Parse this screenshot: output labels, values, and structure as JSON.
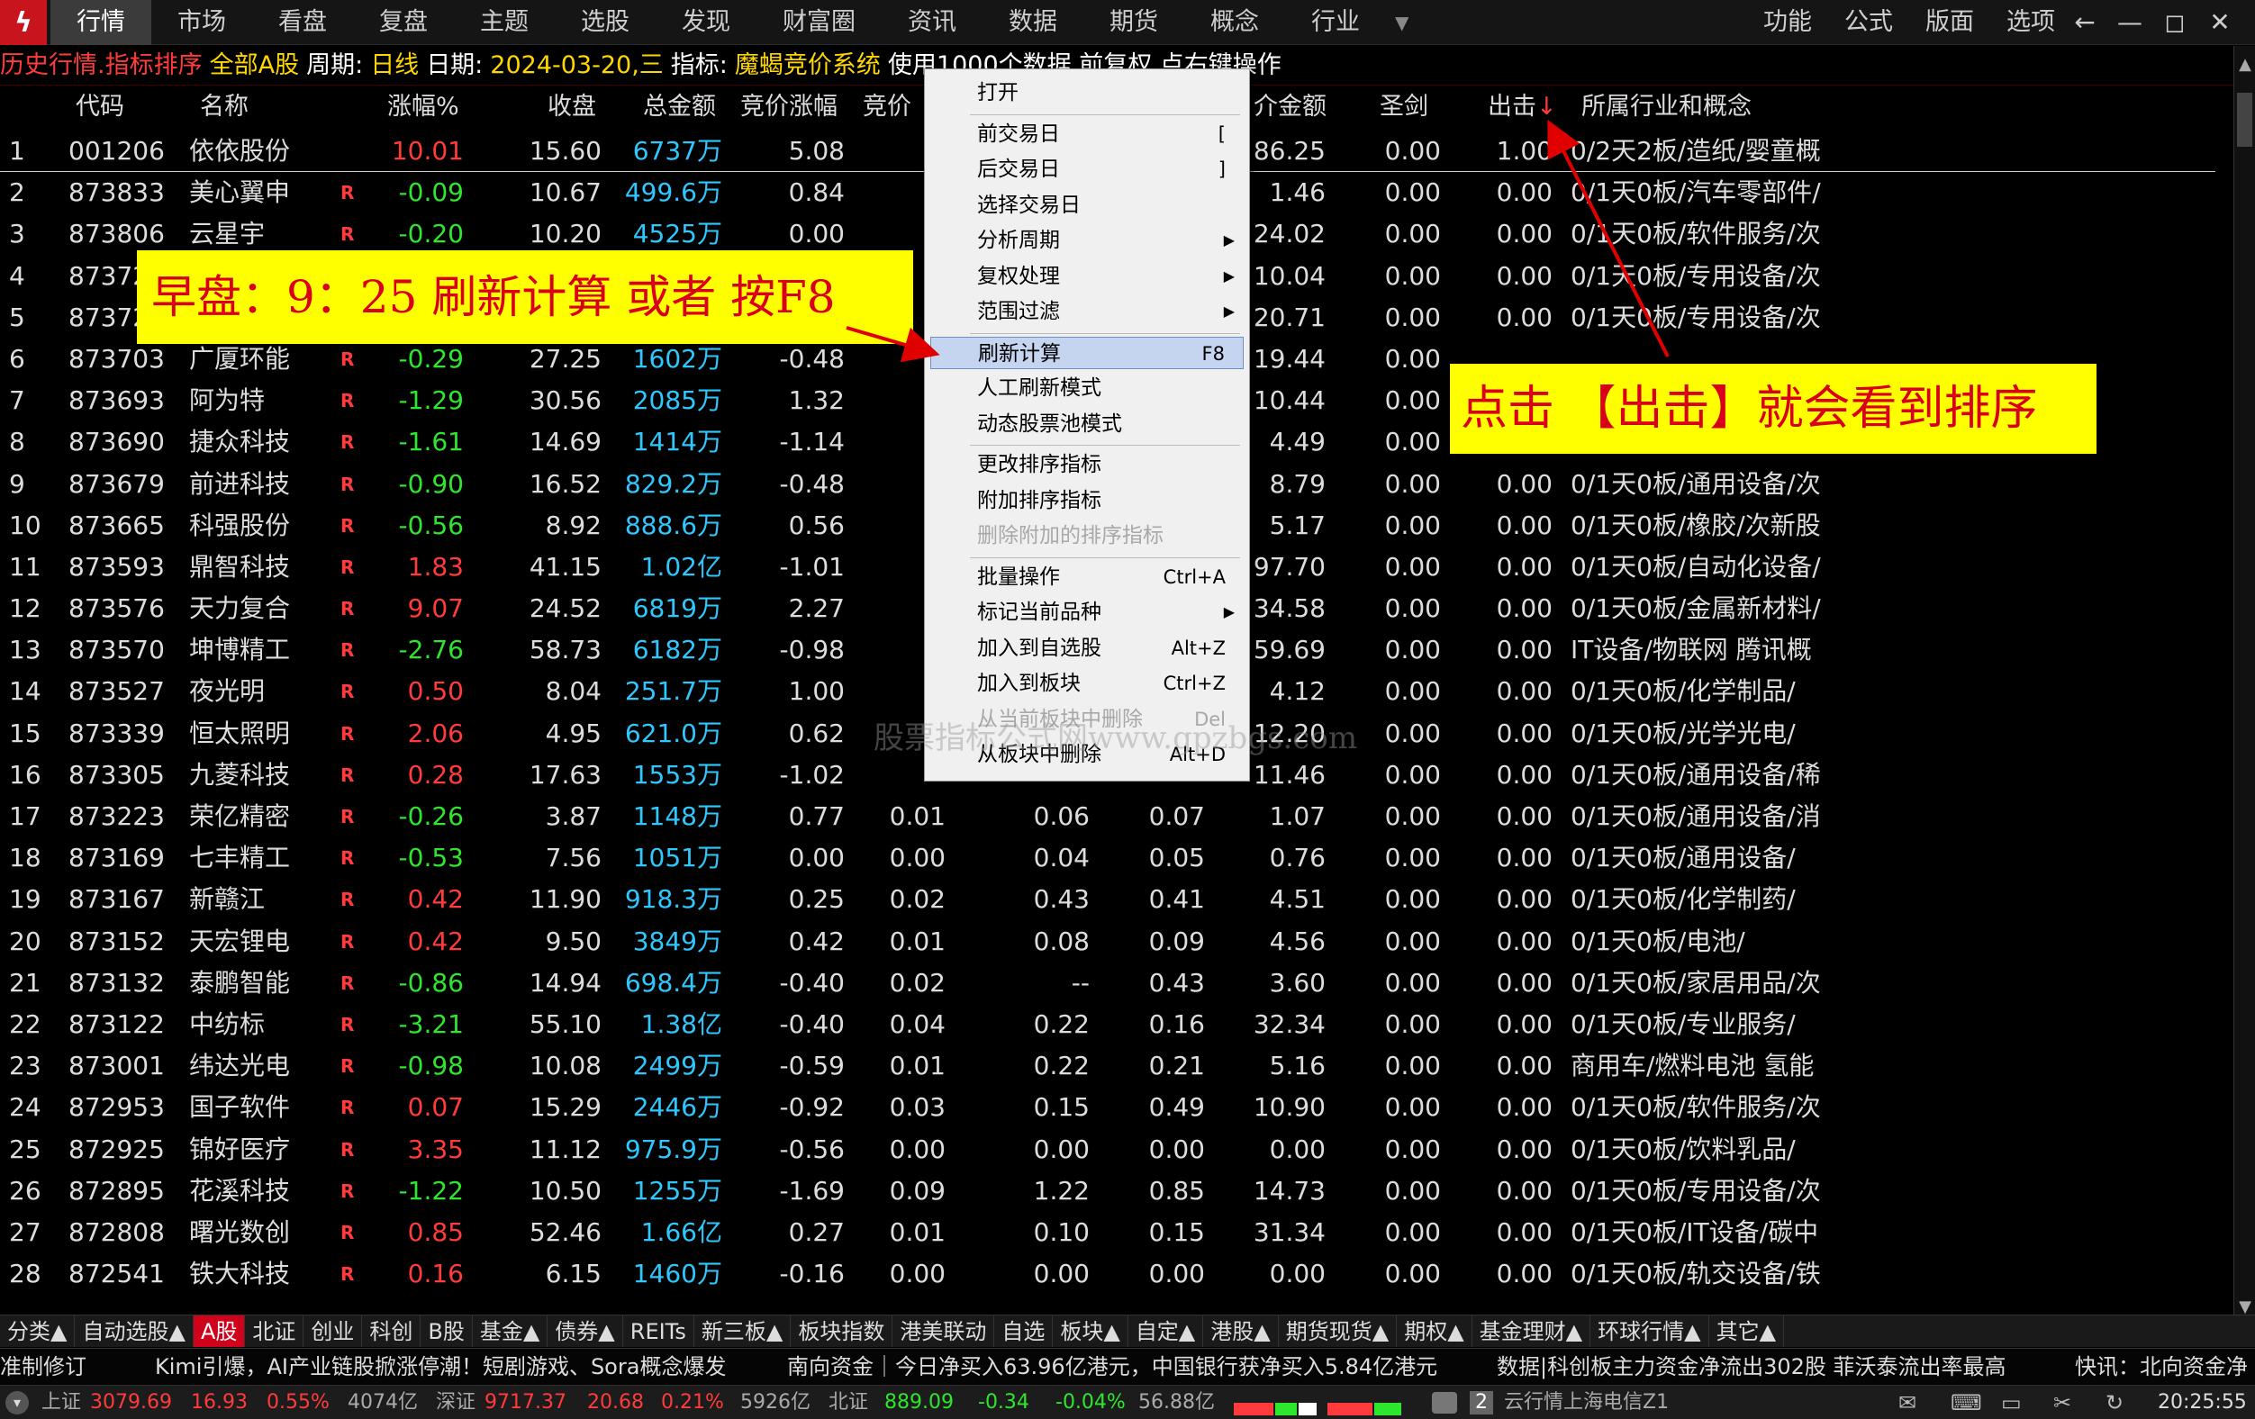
{
  "menubar": {
    "items": [
      "行情",
      "市场",
      "看盘",
      "复盘",
      "主题",
      "选股",
      "发现",
      "财富圈",
      "资讯",
      "数据",
      "期货",
      "概念",
      "行业"
    ],
    "right_items": [
      "功能",
      "公式",
      "版面",
      "选项"
    ],
    "window_controls": [
      "←",
      "—",
      "◻",
      "✕"
    ]
  },
  "infobar": {
    "title": "历史行情.指标排序",
    "market": "全部A股",
    "period_label": "周期:",
    "period": "日线",
    "date_label": "日期:",
    "date": "2024-03-20,三",
    "indicator_label": "指标:",
    "indicator": "魔蝎竞价系统",
    "tail": "使用1000个数据 前复权 点右键操作"
  },
  "columns": {
    "code": "代码",
    "name": "名称",
    "chg": "涨幅%",
    "close": "收盘",
    "amount": "总金额",
    "auc_chg": "竞价涨幅",
    "auc_more": "竞价",
    "v11_label": "介金额",
    "sword": "圣剑",
    "strike": "出击",
    "industry": "所属行业和概念",
    "sort_arrow": "↓"
  },
  "rows": [
    {
      "i": "1",
      "code": "001206",
      "name": "依依股份",
      "r": "",
      "chg": "10.01",
      "close": "15.60",
      "amt": "6737万",
      "auc": "5.08",
      "v6": "",
      "v7": "",
      "v8": "",
      "v9": "86.25",
      "v10": "0.00",
      "v11": "1.00",
      "ind": "0/2天2板/造纸/婴童概"
    },
    {
      "i": "2",
      "code": "873833",
      "name": "美心翼申",
      "r": "R",
      "chg": "-0.09",
      "close": "10.67",
      "amt": "499.6万",
      "auc": "0.84",
      "v6": "",
      "v7": "",
      "v8": "",
      "v9": "1.46",
      "v10": "0.00",
      "v11": "0.00",
      "ind": "0/1天0板/汽车零部件/"
    },
    {
      "i": "3",
      "code": "873806",
      "name": "云星宇",
      "r": "R",
      "chg": "-0.20",
      "close": "10.20",
      "amt": "4525万",
      "auc": "0.00",
      "v6": "",
      "v7": "",
      "v8": "",
      "v9": "24.02",
      "v10": "0.00",
      "v11": "0.00",
      "ind": "0/1天0板/软件服务/次"
    },
    {
      "i": "4",
      "code": "873727",
      "name": "",
      "r": "",
      "chg": "",
      "close": "",
      "amt": "",
      "auc": "",
      "v6": "",
      "v7": "",
      "v8": "",
      "v9": "10.04",
      "v10": "0.00",
      "v11": "0.00",
      "ind": "0/1天0板/专用设备/次"
    },
    {
      "i": "5",
      "code": "873726",
      "name": "",
      "r": "",
      "chg": "",
      "close": "",
      "amt": "",
      "auc": "",
      "v6": "",
      "v7": "",
      "v8": "",
      "v9": "20.71",
      "v10": "0.00",
      "v11": "0.00",
      "ind": "0/1天0板/专用设备/次"
    },
    {
      "i": "6",
      "code": "873703",
      "name": "广厦环能",
      "r": "R",
      "chg": "-0.29",
      "close": "27.25",
      "amt": "1602万",
      "auc": "-0.48",
      "v6": "",
      "v7": "",
      "v8": "",
      "v9": "19.44",
      "v10": "0.00",
      "v11": "",
      "ind": ""
    },
    {
      "i": "7",
      "code": "873693",
      "name": "阿为特",
      "r": "R",
      "chg": "-1.29",
      "close": "30.56",
      "amt": "2085万",
      "auc": "1.32",
      "v6": "",
      "v7": "",
      "v8": "",
      "v9": "10.44",
      "v10": "0.00",
      "v11": "",
      "ind": ""
    },
    {
      "i": "8",
      "code": "873690",
      "name": "捷众科技",
      "r": "R",
      "chg": "-1.61",
      "close": "14.69",
      "amt": "1414万",
      "auc": "-1.14",
      "v6": "",
      "v7": "",
      "v8": "",
      "v9": "4.49",
      "v10": "0.00",
      "v11": "",
      "ind": ""
    },
    {
      "i": "9",
      "code": "873679",
      "name": "前进科技",
      "r": "R",
      "chg": "-0.90",
      "close": "16.52",
      "amt": "829.2万",
      "auc": "-0.48",
      "v6": "",
      "v7": "",
      "v8": "",
      "v9": "8.79",
      "v10": "0.00",
      "v11": "0.00",
      "ind": "0/1天0板/通用设备/次"
    },
    {
      "i": "10",
      "code": "873665",
      "name": "科强股份",
      "r": "R",
      "chg": "-0.56",
      "close": "8.92",
      "amt": "888.6万",
      "auc": "0.56",
      "v6": "",
      "v7": "",
      "v8": "",
      "v9": "5.17",
      "v10": "0.00",
      "v11": "0.00",
      "ind": "0/1天0板/橡胶/次新股"
    },
    {
      "i": "11",
      "code": "873593",
      "name": "鼎智科技",
      "r": "R",
      "chg": "1.83",
      "close": "41.15",
      "amt": "1.02亿",
      "auc": "-1.01",
      "v6": "",
      "v7": "",
      "v8": "",
      "v9": "97.70",
      "v10": "0.00",
      "v11": "0.00",
      "ind": "0/1天0板/自动化设备/"
    },
    {
      "i": "12",
      "code": "873576",
      "name": "天力复合",
      "r": "R",
      "chg": "9.07",
      "close": "24.52",
      "amt": "6819万",
      "auc": "2.27",
      "v6": "",
      "v7": "",
      "v8": "",
      "v9": "34.58",
      "v10": "0.00",
      "v11": "0.00",
      "ind": "0/1天0板/金属新材料/"
    },
    {
      "i": "13",
      "code": "873570",
      "name": "坤博精工",
      "r": "R",
      "chg": "-2.76",
      "close": "58.73",
      "amt": "6182万",
      "auc": "-0.98",
      "v6": "",
      "v7": "",
      "v8": "",
      "v9": "59.69",
      "v10": "0.00",
      "v11": "0.00",
      "ind": "IT设备/物联网 腾讯概"
    },
    {
      "i": "14",
      "code": "873527",
      "name": "夜光明",
      "r": "R",
      "chg": "0.50",
      "close": "8.04",
      "amt": "251.7万",
      "auc": "1.00",
      "v6": "",
      "v7": "",
      "v8": "",
      "v9": "4.12",
      "v10": "0.00",
      "v11": "0.00",
      "ind": "0/1天0板/化学制品/"
    },
    {
      "i": "15",
      "code": "873339",
      "name": "恒太照明",
      "r": "R",
      "chg": "2.06",
      "close": "4.95",
      "amt": "621.0万",
      "auc": "0.62",
      "v6": "",
      "v7": "",
      "v8": "",
      "v9": "12.20",
      "v10": "0.00",
      "v11": "0.00",
      "ind": "0/1天0板/光学光电/"
    },
    {
      "i": "16",
      "code": "873305",
      "name": "九菱科技",
      "r": "R",
      "chg": "0.28",
      "close": "17.63",
      "amt": "1553万",
      "auc": "-1.02",
      "v6": "",
      "v7": "",
      "v8": "",
      "v9": "11.46",
      "v10": "0.00",
      "v11": "0.00",
      "ind": "0/1天0板/通用设备/稀"
    },
    {
      "i": "17",
      "code": "873223",
      "name": "荣亿精密",
      "r": "R",
      "chg": "-0.26",
      "close": "3.87",
      "amt": "1148万",
      "auc": "0.77",
      "v6": "0.01",
      "v7": "0.06",
      "v8": "0.07",
      "v9": "1.07",
      "v10": "0.00",
      "v11": "0.00",
      "ind": "0/1天0板/通用设备/消"
    },
    {
      "i": "18",
      "code": "873169",
      "name": "七丰精工",
      "r": "R",
      "chg": "-0.53",
      "close": "7.56",
      "amt": "1051万",
      "auc": "0.00",
      "v6": "0.00",
      "v7": "0.04",
      "v8": "0.05",
      "v9": "0.76",
      "v10": "0.00",
      "v11": "0.00",
      "ind": "0/1天0板/通用设备/"
    },
    {
      "i": "19",
      "code": "873167",
      "name": "新赣江",
      "r": "R",
      "chg": "0.42",
      "close": "11.90",
      "amt": "918.3万",
      "auc": "0.25",
      "v6": "0.02",
      "v7": "0.43",
      "v8": "0.41",
      "v9": "4.51",
      "v10": "0.00",
      "v11": "0.00",
      "ind": "0/1天0板/化学制药/"
    },
    {
      "i": "20",
      "code": "873152",
      "name": "天宏锂电",
      "r": "R",
      "chg": "0.42",
      "close": "9.50",
      "amt": "3849万",
      "auc": "0.42",
      "v6": "0.01",
      "v7": "0.08",
      "v8": "0.09",
      "v9": "4.56",
      "v10": "0.00",
      "v11": "0.00",
      "ind": "0/1天0板/电池/"
    },
    {
      "i": "21",
      "code": "873132",
      "name": "泰鹏智能",
      "r": "R",
      "chg": "-0.86",
      "close": "14.94",
      "amt": "698.4万",
      "auc": "-0.40",
      "v6": "0.02",
      "v7": "--",
      "v8": "0.43",
      "v9": "3.60",
      "v10": "0.00",
      "v11": "0.00",
      "ind": "0/1天0板/家居用品/次"
    },
    {
      "i": "22",
      "code": "873122",
      "name": "中纺标",
      "r": "R",
      "chg": "-3.21",
      "close": "55.10",
      "amt": "1.38亿",
      "auc": "-0.40",
      "v6": "0.04",
      "v7": "0.22",
      "v8": "0.16",
      "v9": "32.34",
      "v10": "0.00",
      "v11": "0.00",
      "ind": "0/1天0板/专业服务/"
    },
    {
      "i": "23",
      "code": "873001",
      "name": "纬达光电",
      "r": "R",
      "chg": "-0.98",
      "close": "10.08",
      "amt": "2499万",
      "auc": "-0.59",
      "v6": "0.01",
      "v7": "0.22",
      "v8": "0.21",
      "v9": "5.16",
      "v10": "0.00",
      "v11": "0.00",
      "ind": "商用车/燃料电池 氢能"
    },
    {
      "i": "24",
      "code": "872953",
      "name": "国子软件",
      "r": "R",
      "chg": "0.07",
      "close": "15.29",
      "amt": "2446万",
      "auc": "-0.92",
      "v6": "0.03",
      "v7": "0.15",
      "v8": "0.49",
      "v9": "10.90",
      "v10": "0.00",
      "v11": "0.00",
      "ind": "0/1天0板/软件服务/次"
    },
    {
      "i": "25",
      "code": "872925",
      "name": "锦好医疗",
      "r": "R",
      "chg": "3.35",
      "close": "11.12",
      "amt": "975.9万",
      "auc": "-0.56",
      "v6": "0.00",
      "v7": "0.00",
      "v8": "0.00",
      "v9": "0.00",
      "v10": "0.00",
      "v11": "0.00",
      "ind": "0/1天0板/饮料乳品/"
    },
    {
      "i": "26",
      "code": "872895",
      "name": "花溪科技",
      "r": "R",
      "chg": "-1.22",
      "close": "10.50",
      "amt": "1255万",
      "auc": "-1.69",
      "v6": "0.09",
      "v7": "1.22",
      "v8": "0.85",
      "v9": "14.73",
      "v10": "0.00",
      "v11": "0.00",
      "ind": "0/1天0板/专用设备/次"
    },
    {
      "i": "27",
      "code": "872808",
      "name": "曙光数创",
      "r": "R",
      "chg": "0.85",
      "close": "52.46",
      "amt": "1.66亿",
      "auc": "0.27",
      "v6": "0.01",
      "v7": "0.10",
      "v8": "0.15",
      "v9": "31.34",
      "v10": "0.00",
      "v11": "0.00",
      "ind": "0/1天0板/IT设备/碳中"
    },
    {
      "i": "28",
      "code": "872541",
      "name": "铁大科技",
      "r": "R",
      "chg": "0.16",
      "close": "6.15",
      "amt": "1460万",
      "auc": "-0.16",
      "v6": "0.00",
      "v7": "0.00",
      "v8": "0.00",
      "v9": "0.00",
      "v10": "0.00",
      "v11": "0.00",
      "ind": "0/1天0板/轨交设备/铁"
    }
  ],
  "context_menu": {
    "items": [
      {
        "label": "打开",
        "shortcut": "",
        "sub": false,
        "dis": false,
        "hl": false
      },
      {
        "sep": true
      },
      {
        "label": "前交易日",
        "shortcut": "[",
        "sub": false,
        "dis": false,
        "hl": false
      },
      {
        "label": "后交易日",
        "shortcut": "]",
        "sub": false,
        "dis": false,
        "hl": false
      },
      {
        "label": "选择交易日",
        "shortcut": "",
        "sub": false,
        "dis": false,
        "hl": false
      },
      {
        "label": "分析周期",
        "shortcut": "",
        "sub": true,
        "dis": false,
        "hl": false
      },
      {
        "label": "复权处理",
        "shortcut": "",
        "sub": true,
        "dis": false,
        "hl": false
      },
      {
        "label": "范围过滤",
        "shortcut": "",
        "sub": true,
        "dis": false,
        "hl": false
      },
      {
        "sep": true
      },
      {
        "label": "刷新计算",
        "shortcut": "F8",
        "sub": false,
        "dis": false,
        "hl": true
      },
      {
        "label": "人工刷新模式",
        "shortcut": "",
        "sub": false,
        "dis": false,
        "hl": false
      },
      {
        "label": "动态股票池模式",
        "shortcut": "",
        "sub": false,
        "dis": false,
        "hl": false
      },
      {
        "sep": true
      },
      {
        "label": "更改排序指标",
        "shortcut": "",
        "sub": false,
        "dis": false,
        "hl": false
      },
      {
        "label": "附加排序指标",
        "shortcut": "",
        "sub": false,
        "dis": false,
        "hl": false
      },
      {
        "label": "删除附加的排序指标",
        "shortcut": "",
        "sub": false,
        "dis": true,
        "hl": false
      },
      {
        "sep": true
      },
      {
        "label": "批量操作",
        "shortcut": "Ctrl+A",
        "sub": false,
        "dis": false,
        "hl": false
      },
      {
        "label": "标记当前品种",
        "shortcut": "",
        "sub": true,
        "dis": false,
        "hl": false
      },
      {
        "label": "加入到自选股",
        "shortcut": "Alt+Z",
        "sub": false,
        "dis": false,
        "hl": false
      },
      {
        "label": "加入到板块",
        "shortcut": "Ctrl+Z",
        "sub": false,
        "dis": false,
        "hl": false
      },
      {
        "label": "从当前板块中删除",
        "shortcut": "Del",
        "sub": false,
        "dis": true,
        "hl": false
      },
      {
        "label": "从板块中删除",
        "shortcut": "Alt+D",
        "sub": false,
        "dis": false,
        "hl": false
      }
    ]
  },
  "callouts": {
    "left": "早盘：9：25 刷新计算 或者 按F8",
    "right": "点击 【出击】就会看到排序"
  },
  "watermark": "股票指标公式网www.gpzbgs.com",
  "tabs": [
    "分类▲",
    "自动选股▲",
    "A股",
    "北证",
    "创业",
    "科创",
    "B股",
    "基金▲",
    "债券▲",
    "REITs",
    "新三板▲",
    "板块指数",
    "港美联动",
    "自选",
    "板块▲",
    "自定▲",
    "港股▲",
    "期货现货▲",
    "期权▲",
    "基金理财▲",
    "环球行情▲",
    "其它▲"
  ],
  "active_tab": "A股",
  "ticker": {
    "a": "准制修订",
    "b": "Kimi引爆，AI产业链股掀涨停潮！短剧游戏、Sora概念爆发",
    "c": "南向资金｜今日净买入63.96亿港元，中国银行获净买入5.84亿港元",
    "d": "数据|科创板主力资金净流出302股 菲沃泰流出率最高",
    "e": "快讯：北向资金净"
  },
  "status": {
    "sh_label": "上证",
    "sh_val": "3079.69",
    "sh_chg": "16.93",
    "sh_pct": "0.55%",
    "sh_amt": "4074亿",
    "sz_label": "深证",
    "sz_val": "9717.37",
    "sz_chg": "20.68",
    "sz_pct": "0.21%",
    "sz_amt": "5926亿",
    "bz_label": "北证",
    "bz_val": "889.09",
    "bz_chg": "-0.34",
    "bz_pct": "-0.04%",
    "bz_amt": "56.88亿",
    "server": "云行情上海电信Z1",
    "server_num": "2",
    "time": "20:25:55"
  },
  "colors": {
    "accent": "#d0021b",
    "up": "#ff3b3b",
    "down": "#2ee62e",
    "amount": "#2ec8ff",
    "callout_bg": "#ffff00"
  }
}
